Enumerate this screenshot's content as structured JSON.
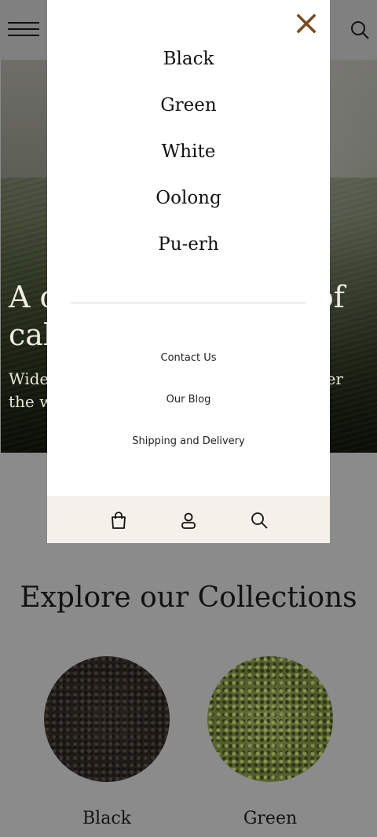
{
  "header": {
    "menu_icon": "hamburger-icon",
    "search_icon": "search-icon"
  },
  "hero": {
    "title_visible_start": "A c",
    "title_visible_second_line": "cal",
    "title_visible_end": "of",
    "subtitle_visible_start": "Wide",
    "subtitle_visible_second_line": "the w",
    "subtitle_visible_end": "over"
  },
  "drawer": {
    "close_icon": "close-icon",
    "menu_items": [
      {
        "label": "Black"
      },
      {
        "label": "Green"
      },
      {
        "label": "White"
      },
      {
        "label": "Oolong"
      },
      {
        "label": "Pu-erh"
      }
    ],
    "links": [
      {
        "label": "Contact Us"
      },
      {
        "label": "Our Blog"
      },
      {
        "label": "Shipping and Delivery"
      }
    ],
    "footer_icons": [
      "bag-icon",
      "account-icon",
      "search-icon"
    ]
  },
  "collections": {
    "title": "Explore our Collections",
    "items": [
      {
        "label": "Black"
      },
      {
        "label": "Green"
      }
    ]
  },
  "colors": {
    "close_accent": "#7a4a1f",
    "drawer_footer_bg": "#f5f0ea",
    "overlay": "#808080"
  }
}
